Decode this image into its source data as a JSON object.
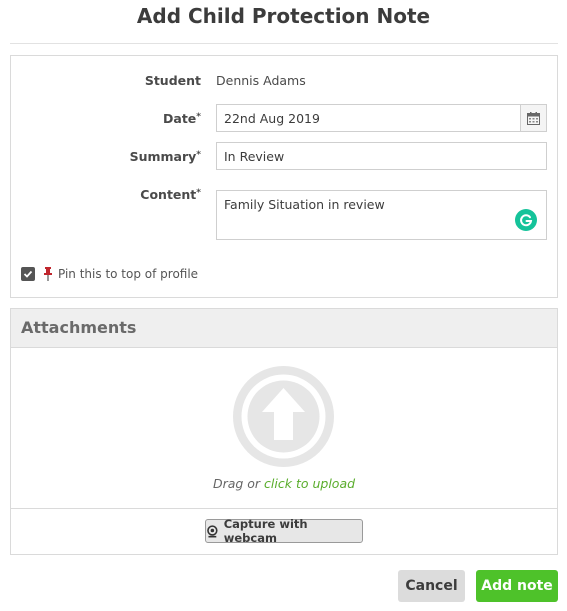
{
  "dialog": {
    "title": "Add Child Protection Note"
  },
  "form": {
    "student": {
      "label": "Student",
      "value": "Dennis Adams"
    },
    "date": {
      "label": "Date",
      "required_mark": "*",
      "value": "22nd Aug 2019"
    },
    "summary": {
      "label": "Summary",
      "required_mark": "*",
      "value": "In Review"
    },
    "content": {
      "label": "Content",
      "required_mark": "*",
      "value": "Family Situation in review"
    },
    "pin": {
      "label": "Pin this to top of profile",
      "checked": true
    }
  },
  "attachments": {
    "header": "Attachments",
    "drag_text": "Drag or",
    "upload_link": "click to upload",
    "webcam_label": "Capture with webcam"
  },
  "actions": {
    "cancel_label": "Cancel",
    "add_label": "Add note"
  },
  "colors": {
    "accent_green": "#4ec22a",
    "link_green": "#5aad2c",
    "pin_red": "#c0262d",
    "grammarly": "#15c39a"
  },
  "icons": {
    "calendar": "calendar-icon",
    "grammarly": "grammarly-icon",
    "pin": "pushpin-icon",
    "upload": "upload-arrow-icon",
    "webcam": "webcam-icon",
    "checkbox": "checkmark-icon"
  }
}
